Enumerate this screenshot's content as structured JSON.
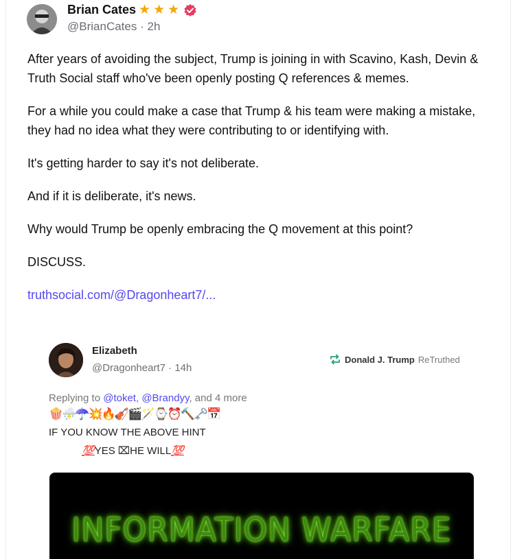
{
  "post": {
    "author_name": "Brian Cates",
    "stars": [
      "★",
      "★",
      "★"
    ],
    "verified_icon": "verified-badge-icon",
    "handle": "@BrianCates",
    "separator": "·",
    "time": "2h",
    "paragraphs": [
      "After years of avoiding the subject, Trump is joining in with Scavino, Kash, Devin & Truth Social staff who've been openly posting Q references & memes.",
      "For a while you could make a case that Trump & his team were making a mistake, they had no idea what they were contributing to or identifying with.",
      "It's getting harder to say it's not deliberate.",
      "And if it is deliberate, it's news.",
      "Why would Trump be openly embracing the Q movement at this point?",
      "DISCUSS."
    ],
    "link": "truthsocial.com/@Dragonheart7/..."
  },
  "embed": {
    "author_name": "Elizabeth",
    "handle": "@Dragonheart7",
    "separator": "·",
    "time": "14h",
    "retruth_name": "Donald J. Trump",
    "retruth_label": "ReTruthed",
    "reply_prefix": "Replying to",
    "mention_1": "@toket",
    "comma": ",",
    "mention_2": "@Brandyy",
    "reply_suffix": ", and 4 more",
    "emoji_line": "🍿⛈️☂️💥🔥🎻🎬🪄⌚⏰🔨🗝️📅",
    "hint_line": "IF YOU KNOW THE ABOVE HINT",
    "hundred": "💯",
    "yes_text": "YES ⌧HE WILL",
    "video_title": "INFORMATION WARFARE"
  },
  "colors": {
    "star": "#f2a900",
    "verified": "#e33d63",
    "link": "#5448ee",
    "retruth_icon": "#2a9d6b",
    "video_glow": "#6dde1a"
  }
}
